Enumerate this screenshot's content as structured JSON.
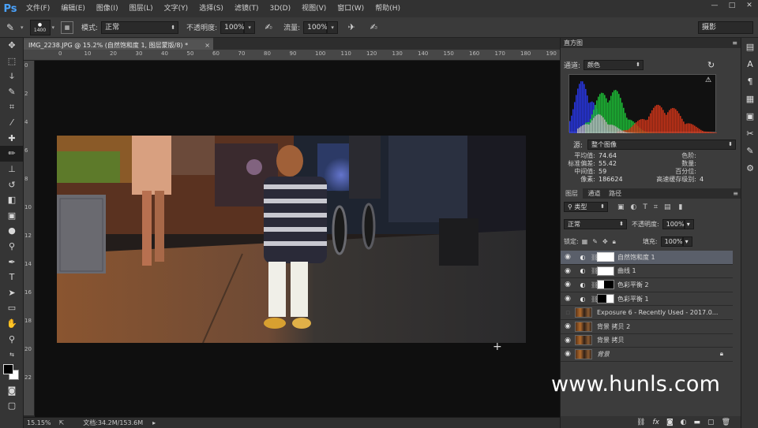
{
  "app": {
    "logo": "Ps"
  },
  "menubar": {
    "items": [
      "文件(F)",
      "编辑(E)",
      "图像(I)",
      "图层(L)",
      "文字(Y)",
      "选择(S)",
      "滤镜(T)",
      "3D(D)",
      "视图(V)",
      "窗口(W)",
      "帮助(H)"
    ],
    "controls": [
      "—",
      "□",
      "✕"
    ]
  },
  "options": {
    "brush_size": "1400",
    "mode_label": "模式:",
    "mode_value": "正常",
    "opacity_label": "不透明度:",
    "opacity_value": "100%",
    "flow_label": "流量:",
    "flow_value": "100%",
    "workspace": "摄影"
  },
  "document": {
    "tab_title": "IMG_2238.JPG @ 15.2% (自然饱和度 1, 图层蒙版/8) *",
    "close": "×",
    "ruler_h": [
      "0",
      "10",
      "20",
      "30",
      "40",
      "50",
      "60",
      "70",
      "80",
      "90",
      "100",
      "110",
      "120",
      "130",
      "140",
      "150",
      "160",
      "170",
      "180",
      "190"
    ],
    "ruler_v": [
      "0",
      "2",
      "4",
      "6",
      "8",
      "10",
      "12",
      "14",
      "16",
      "18",
      "20",
      "22"
    ]
  },
  "status": {
    "zoom": "15.15%",
    "doc_size": "文档:34.2M/153.6M"
  },
  "histogram": {
    "title": "直方图",
    "channel_label": "通道:",
    "channel_value": "颜色",
    "source_label": "源:",
    "source_value": "整个图像",
    "stats_left": [
      {
        "label": "平均值:",
        "value": "74.64"
      },
      {
        "label": "标准偏差:",
        "value": "55.42"
      },
      {
        "label": "中间值:",
        "value": "59"
      },
      {
        "label": "像素:",
        "value": "186624"
      }
    ],
    "stats_right": [
      {
        "label": "色阶:",
        "value": ""
      },
      {
        "label": "数量:",
        "value": ""
      },
      {
        "label": "百分位:",
        "value": ""
      },
      {
        "label": "高速缓存级别:",
        "value": "4"
      }
    ]
  },
  "layers_panel": {
    "tabs": [
      "图层",
      "通道",
      "路径"
    ],
    "kind_filter": "类型",
    "blend_mode": "正常",
    "opacity_label": "不透明度:",
    "opacity_value": "100%",
    "lock_label": "锁定:",
    "fill_label": "填充:",
    "fill_value": "100%",
    "layers": [
      {
        "name": "自然饱和度 1",
        "type": "adjustment",
        "selected": true
      },
      {
        "name": "曲线 1",
        "type": "adjustment",
        "selected": false
      },
      {
        "name": "色彩平衡 2",
        "type": "adjustment",
        "selected": false
      },
      {
        "name": "色彩平衡 1",
        "type": "adjustment",
        "selected": false
      },
      {
        "name": "Exposure 6 - Recently Used - 2017.0...",
        "type": "image",
        "selected": false
      },
      {
        "name": "背景 拷贝 2",
        "type": "image",
        "selected": false
      },
      {
        "name": "背景 拷贝",
        "type": "image",
        "selected": false
      },
      {
        "name": "背景",
        "type": "image",
        "selected": false
      }
    ],
    "footer_icons": [
      "link-icon",
      "fx-icon",
      "mask-icon",
      "adjustment-icon",
      "folder-icon",
      "new-layer-icon",
      "trash-icon"
    ]
  },
  "watermark": "www.hunls.com"
}
